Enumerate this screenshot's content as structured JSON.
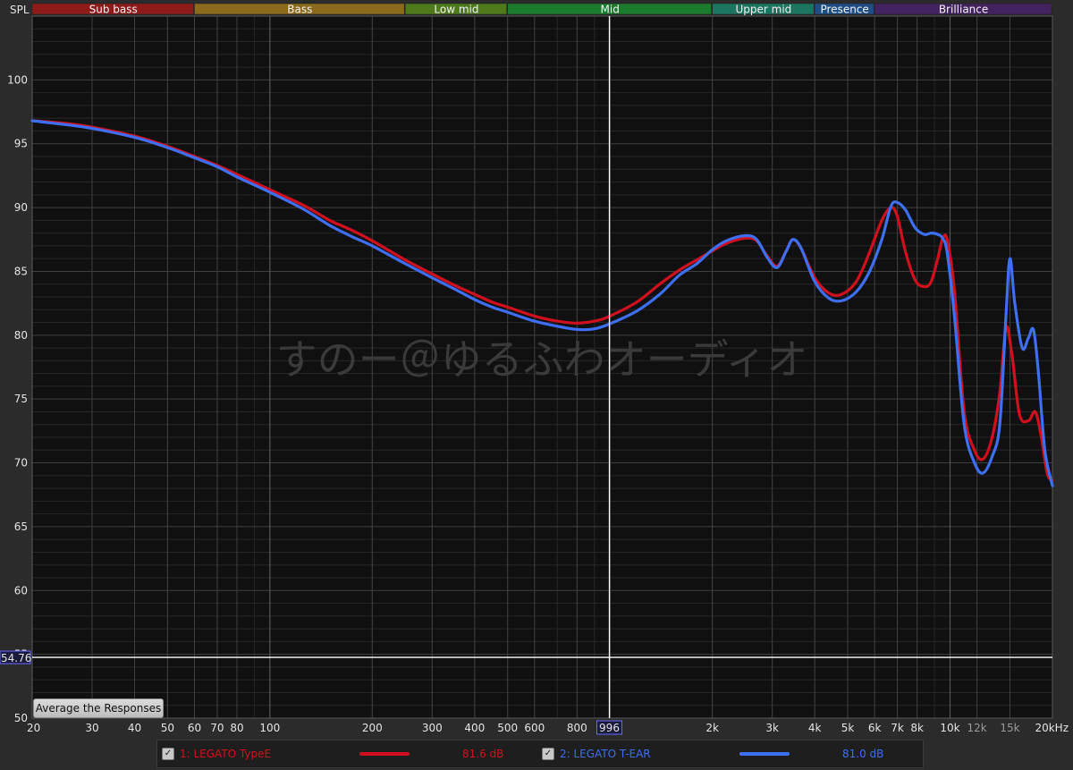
{
  "colors": {
    "series1": "#d0101e",
    "series2": "#3e6ff2",
    "watermark": "#3a3a3a",
    "cursor_line": "#ffffff"
  },
  "bands": [
    {
      "name": "Sub bass",
      "from": 20,
      "to": 60,
      "color": "#8e1a1a"
    },
    {
      "name": "Bass",
      "from": 60,
      "to": 250,
      "color": "#8b6a1c"
    },
    {
      "name": "Low mid",
      "from": 250,
      "to": 500,
      "color": "#4f7a1c"
    },
    {
      "name": "Mid",
      "from": 500,
      "to": 2000,
      "color": "#1c7a2c"
    },
    {
      "name": "Upper mid",
      "from": 2000,
      "to": 4000,
      "color": "#1b7660"
    },
    {
      "name": "Presence",
      "from": 4000,
      "to": 6000,
      "color": "#1f4e86"
    },
    {
      "name": "Brilliance",
      "from": 6000,
      "to": 20000,
      "color": "#43235f"
    }
  ],
  "chart_data": {
    "type": "line",
    "ylabel": "SPL",
    "xscale": "log",
    "xlim": [
      20,
      20000
    ],
    "ylim": [
      50,
      105
    ],
    "x_ticks": [
      {
        "value": 20,
        "label": "20"
      },
      {
        "value": 30,
        "label": "30"
      },
      {
        "value": 40,
        "label": "40"
      },
      {
        "value": 50,
        "label": "50"
      },
      {
        "value": 60,
        "label": "60"
      },
      {
        "value": 70,
        "label": "70"
      },
      {
        "value": 80,
        "label": "80"
      },
      {
        "value": 100,
        "label": "100"
      },
      {
        "value": 200,
        "label": "200"
      },
      {
        "value": 300,
        "label": "300"
      },
      {
        "value": 400,
        "label": "400"
      },
      {
        "value": 500,
        "label": "500"
      },
      {
        "value": 600,
        "label": "600"
      },
      {
        "value": 800,
        "label": "800"
      },
      {
        "value": 2000,
        "label": "2k"
      },
      {
        "value": 3000,
        "label": "3k"
      },
      {
        "value": 4000,
        "label": "4k"
      },
      {
        "value": 5000,
        "label": "5k"
      },
      {
        "value": 6000,
        "label": "6k"
      },
      {
        "value": 7000,
        "label": "7k"
      },
      {
        "value": 8000,
        "label": "8k"
      },
      {
        "value": 10000,
        "label": "10k"
      },
      {
        "value": 12000,
        "label": "12k",
        "dim": true
      },
      {
        "value": 15000,
        "label": "15k",
        "dim": true
      },
      {
        "value": 20000,
        "label": "20kHz"
      }
    ],
    "y_ticks": [
      50,
      55,
      60,
      65,
      70,
      75,
      80,
      85,
      90,
      95,
      100
    ],
    "cursor": {
      "frequency": 996,
      "frequency_label": "996",
      "level": 54.76,
      "level_label": "54.76"
    },
    "watermark": "すのー＠ゆるふわオーディオ",
    "series": [
      {
        "name": "1: LEGATO TypeE",
        "level": "81.6 dB",
        "points": [
          [
            20,
            96.8
          ],
          [
            25,
            96.6
          ],
          [
            30,
            96.3
          ],
          [
            40,
            95.6
          ],
          [
            50,
            94.8
          ],
          [
            60,
            94.0
          ],
          [
            70,
            93.3
          ],
          [
            80,
            92.6
          ],
          [
            100,
            91.4
          ],
          [
            125,
            90.2
          ],
          [
            150,
            89.0
          ],
          [
            175,
            88.2
          ],
          [
            200,
            87.4
          ],
          [
            250,
            85.9
          ],
          [
            300,
            84.8
          ],
          [
            350,
            83.9
          ],
          [
            400,
            83.2
          ],
          [
            450,
            82.6
          ],
          [
            500,
            82.2
          ],
          [
            600,
            81.5
          ],
          [
            700,
            81.1
          ],
          [
            800,
            80.95
          ],
          [
            900,
            81.1
          ],
          [
            1000,
            81.5
          ],
          [
            1200,
            82.6
          ],
          [
            1400,
            84.0
          ],
          [
            1600,
            85.1
          ],
          [
            1800,
            85.9
          ],
          [
            2000,
            86.6
          ],
          [
            2200,
            87.2
          ],
          [
            2500,
            87.6
          ],
          [
            2700,
            87.4
          ],
          [
            2900,
            86.2
          ],
          [
            3100,
            85.4
          ],
          [
            3300,
            86.6
          ],
          [
            3450,
            87.5
          ],
          [
            3650,
            86.8
          ],
          [
            4000,
            84.5
          ],
          [
            4400,
            83.3
          ],
          [
            4800,
            83.2
          ],
          [
            5300,
            84.2
          ],
          [
            5800,
            86.5
          ],
          [
            6300,
            89.0
          ],
          [
            6700,
            90.0
          ],
          [
            7000,
            89.3
          ],
          [
            7400,
            86.5
          ],
          [
            7900,
            84.3
          ],
          [
            8400,
            83.8
          ],
          [
            8800,
            84.2
          ],
          [
            9200,
            86.0
          ],
          [
            9500,
            87.5
          ],
          [
            9800,
            87.5
          ],
          [
            10300,
            83.5
          ],
          [
            11000,
            74.0
          ],
          [
            11800,
            71.0
          ],
          [
            12500,
            70.3
          ],
          [
            13300,
            72.0
          ],
          [
            14000,
            75.5
          ],
          [
            14600,
            80.6
          ],
          [
            15200,
            78.5
          ],
          [
            16000,
            73.8
          ],
          [
            17000,
            73.3
          ],
          [
            17800,
            74.0
          ],
          [
            18500,
            72.2
          ],
          [
            19300,
            69.2
          ],
          [
            20000,
            68.6
          ]
        ]
      },
      {
        "name": "2: LEGATO T-EAR",
        "level": "81.0 dB",
        "points": [
          [
            20,
            96.8
          ],
          [
            25,
            96.5
          ],
          [
            30,
            96.2
          ],
          [
            40,
            95.5
          ],
          [
            50,
            94.7
          ],
          [
            60,
            93.9
          ],
          [
            70,
            93.2
          ],
          [
            80,
            92.4
          ],
          [
            100,
            91.2
          ],
          [
            125,
            89.9
          ],
          [
            150,
            88.6
          ],
          [
            175,
            87.7
          ],
          [
            200,
            87.0
          ],
          [
            250,
            85.6
          ],
          [
            300,
            84.5
          ],
          [
            350,
            83.6
          ],
          [
            400,
            82.8
          ],
          [
            450,
            82.2
          ],
          [
            500,
            81.8
          ],
          [
            600,
            81.1
          ],
          [
            700,
            80.7
          ],
          [
            800,
            80.45
          ],
          [
            900,
            80.5
          ],
          [
            1000,
            80.9
          ],
          [
            1200,
            81.9
          ],
          [
            1400,
            83.2
          ],
          [
            1600,
            84.7
          ],
          [
            1800,
            85.6
          ],
          [
            2000,
            86.7
          ],
          [
            2200,
            87.4
          ],
          [
            2500,
            87.8
          ],
          [
            2700,
            87.5
          ],
          [
            2900,
            86.1
          ],
          [
            3100,
            85.3
          ],
          [
            3300,
            86.6
          ],
          [
            3450,
            87.5
          ],
          [
            3650,
            86.8
          ],
          [
            4000,
            84.2
          ],
          [
            4400,
            82.9
          ],
          [
            4800,
            82.7
          ],
          [
            5300,
            83.4
          ],
          [
            5800,
            85.0
          ],
          [
            6300,
            87.5
          ],
          [
            6700,
            90.1
          ],
          [
            7000,
            90.4
          ],
          [
            7400,
            89.8
          ],
          [
            7900,
            88.4
          ],
          [
            8400,
            87.9
          ],
          [
            8800,
            88.0
          ],
          [
            9200,
            87.9
          ],
          [
            9500,
            87.6
          ],
          [
            9800,
            86.5
          ],
          [
            10300,
            81.5
          ],
          [
            11000,
            73.0
          ],
          [
            11800,
            70.0
          ],
          [
            12500,
            69.2
          ],
          [
            13300,
            70.5
          ],
          [
            14000,
            73.0
          ],
          [
            14600,
            81.5
          ],
          [
            15000,
            86.0
          ],
          [
            15500,
            82.5
          ],
          [
            16300,
            79.0
          ],
          [
            17000,
            79.8
          ],
          [
            17600,
            80.4
          ],
          [
            18200,
            77.0
          ],
          [
            19000,
            71.0
          ],
          [
            20000,
            68.2
          ]
        ]
      }
    ]
  },
  "toolbar": {
    "average_button": "Average the Responses"
  },
  "legend": {
    "checkbox_glyph": "✓"
  }
}
